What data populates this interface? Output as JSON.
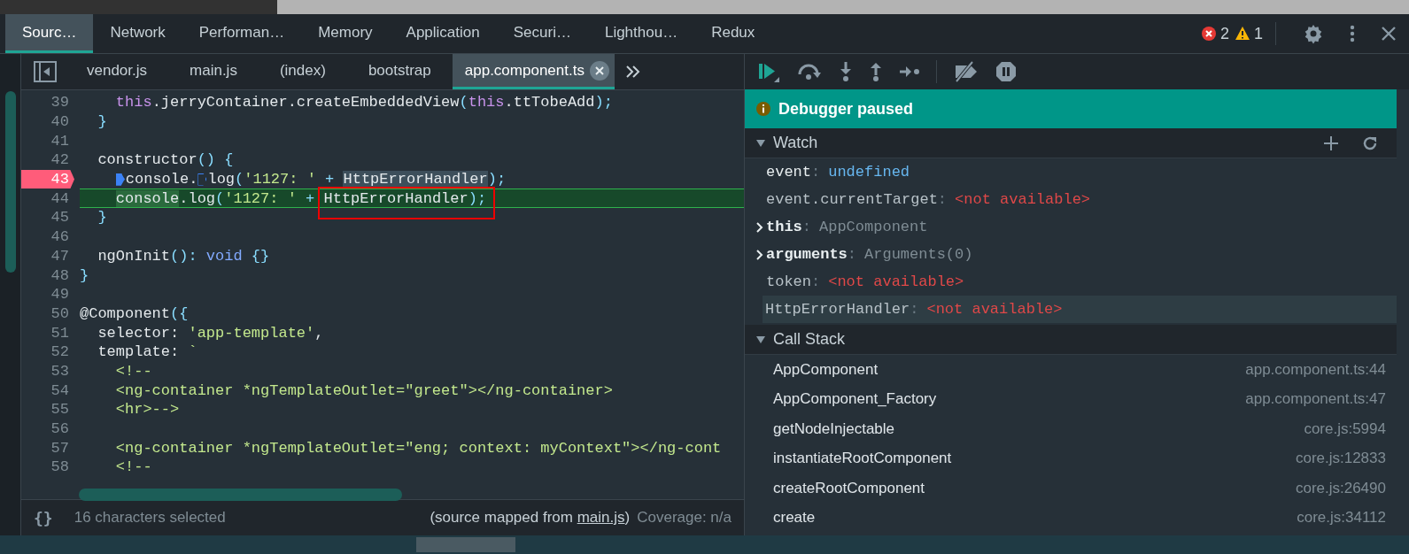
{
  "main_tabs": [
    {
      "label": "Sourc…",
      "selected": true
    },
    {
      "label": "Network",
      "selected": false
    },
    {
      "label": "Performan…",
      "selected": false
    },
    {
      "label": "Memory",
      "selected": false
    },
    {
      "label": "Application",
      "selected": false
    },
    {
      "label": "Securi…",
      "selected": false
    },
    {
      "label": "Lighthou…",
      "selected": false
    },
    {
      "label": "Redux",
      "selected": false
    }
  ],
  "errors": "2",
  "warnings": "1",
  "file_tabs": [
    {
      "label": "vendor.js",
      "selected": false
    },
    {
      "label": "main.js",
      "selected": false
    },
    {
      "label": "(index)",
      "selected": false
    },
    {
      "label": "bootstrap",
      "selected": false
    },
    {
      "label": "app.component.ts",
      "selected": true
    }
  ],
  "code": [
    {
      "num": "39",
      "breakpoint": false,
      "current": false,
      "segments": [
        {
          "t": "    this",
          "kind": "keyword"
        },
        {
          "t": ".jerryContainer.createEmbeddedView",
          "kind": "plain"
        },
        {
          "t": "(",
          "kind": "punct"
        },
        {
          "t": "this",
          "kind": "keyword"
        },
        {
          "t": ".ttTobeAdd",
          "kind": "plain"
        },
        {
          "t": ");",
          "kind": "punct"
        }
      ]
    },
    {
      "num": "40",
      "breakpoint": false,
      "current": false,
      "segments": [
        {
          "t": "  }",
          "kind": "punct"
        }
      ]
    },
    {
      "num": "41",
      "breakpoint": false,
      "current": false
    },
    {
      "num": "42",
      "breakpoint": false,
      "current": false,
      "segments": [
        {
          "t": "  constructor",
          "kind": "plain"
        },
        {
          "t": "() {",
          "kind": "punct"
        }
      ]
    },
    {
      "num": "43",
      "breakpoint": true,
      "current": false,
      "segments": [
        {
          "t": "    console.",
          "kind": "plain",
          "marker_active": true
        },
        {
          "t": "log",
          "kind": "plain",
          "marker_active": false
        },
        {
          "t": "(",
          "kind": "punct"
        },
        {
          "t": "'1127: '",
          "kind": "string"
        },
        {
          "t": " + ",
          "kind": "punct"
        },
        {
          "t": "HttpErrorHandler",
          "kind": "selection"
        },
        {
          "t": ");",
          "kind": "punct"
        }
      ]
    },
    {
      "num": "44",
      "breakpoint": false,
      "current": true,
      "segments": [
        {
          "t": "    console",
          "kind": "selection"
        },
        {
          "t": ".log",
          "kind": "plain"
        },
        {
          "t": "(",
          "kind": "punct"
        },
        {
          "t": "'1127: '",
          "kind": "string"
        },
        {
          "t": " + ",
          "kind": "punct"
        },
        {
          "t": "HttpErrorHandler",
          "kind": "boxed"
        },
        {
          "t": ");",
          "kind": "punct"
        }
      ]
    },
    {
      "num": "45",
      "breakpoint": false,
      "current": false,
      "segments": [
        {
          "t": "  }",
          "kind": "punct"
        }
      ]
    },
    {
      "num": "46",
      "breakpoint": false,
      "current": false
    },
    {
      "num": "47",
      "breakpoint": false,
      "current": false,
      "segments": [
        {
          "t": "  ngOnInit",
          "kind": "plain"
        },
        {
          "t": "(): ",
          "kind": "punct"
        },
        {
          "t": "void",
          "kind": "type"
        },
        {
          "t": " {}",
          "kind": "punct"
        }
      ]
    },
    {
      "num": "48",
      "breakpoint": false,
      "current": false,
      "segments": [
        {
          "t": "}",
          "kind": "punct"
        }
      ]
    },
    {
      "num": "49",
      "breakpoint": false,
      "current": false
    },
    {
      "num": "50",
      "breakpoint": false,
      "current": false,
      "segments": [
        {
          "t": "@Component",
          "kind": "plain"
        },
        {
          "t": "({",
          "kind": "punct"
        }
      ]
    },
    {
      "num": "51",
      "breakpoint": false,
      "current": false,
      "segments": [
        {
          "t": "  selector: ",
          "kind": "plain"
        },
        {
          "t": "'app-template'",
          "kind": "string"
        },
        {
          "t": ",",
          "kind": "plain"
        }
      ]
    },
    {
      "num": "52",
      "breakpoint": false,
      "current": false,
      "segments": [
        {
          "t": "  template: ",
          "kind": "plain"
        },
        {
          "t": "`",
          "kind": "string"
        }
      ]
    },
    {
      "num": "53",
      "breakpoint": false,
      "current": false,
      "segments": [
        {
          "t": "    <!--",
          "kind": "string"
        }
      ]
    },
    {
      "num": "54",
      "breakpoint": false,
      "current": false,
      "segments": [
        {
          "t": "    <ng-container *ngTemplateOutlet=\"greet\"></ng-container>",
          "kind": "string"
        }
      ]
    },
    {
      "num": "55",
      "breakpoint": false,
      "current": false,
      "segments": [
        {
          "t": "    <hr>-->",
          "kind": "string"
        }
      ]
    },
    {
      "num": "56",
      "breakpoint": false,
      "current": false
    },
    {
      "num": "57",
      "breakpoint": false,
      "current": false,
      "segments": [
        {
          "t": "    <ng-container *ngTemplateOutlet=\"eng; context: myContext\"></ng-cont",
          "kind": "string"
        }
      ]
    },
    {
      "num": "58",
      "breakpoint": false,
      "current": false,
      "segments": [
        {
          "t": "    <!--",
          "kind": "string"
        }
      ]
    }
  ],
  "status": {
    "pretty_print": "{}",
    "selection": "16 characters selected",
    "mapped_prefix": "(source mapped from ",
    "mapped_link": "main.js",
    "mapped_suffix": ")",
    "coverage": "Coverage: n/a"
  },
  "banner": "Debugger paused",
  "watch": {
    "title": "Watch",
    "expanded": true,
    "items": [
      {
        "name": "event",
        "separator": ":",
        "value": "undefined",
        "kind": "defined",
        "expandable": false,
        "selected": false
      },
      {
        "name": "event.currentTarget",
        "separator": ":",
        "value": "<not available>",
        "kind": "error",
        "expandable": false,
        "selected": false
      },
      {
        "name": "this",
        "separator": ":",
        "value": "AppComponent",
        "kind": "object",
        "expandable": true,
        "selected": false
      },
      {
        "name": "arguments",
        "separator": ":",
        "value": "Arguments(0)",
        "kind": "object",
        "expandable": true,
        "selected": false
      },
      {
        "name": "token",
        "separator": ":",
        "value": "<not available>",
        "kind": "error",
        "expandable": false,
        "selected": false
      },
      {
        "name": "HttpErrorHandler",
        "separator": ":",
        "value": "<not available>",
        "kind": "error",
        "expandable": false,
        "selected": true
      }
    ]
  },
  "call_stack": {
    "title": "Call Stack",
    "expanded": true,
    "frames": [
      {
        "name": "AppComponent",
        "location": "app.component.ts:44"
      },
      {
        "name": "AppComponent_Factory",
        "location": "app.component.ts:47"
      },
      {
        "name": "getNodeInjectable",
        "location": "core.js:5994"
      },
      {
        "name": "instantiateRootComponent",
        "location": "core.js:12833"
      },
      {
        "name": "createRootComponent",
        "location": "core.js:26490"
      },
      {
        "name": "create",
        "location": "core.js:34112"
      }
    ]
  }
}
